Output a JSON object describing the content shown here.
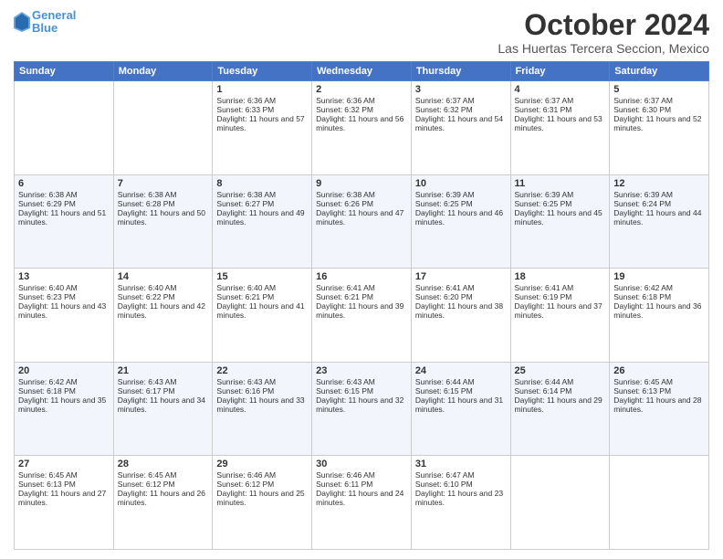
{
  "header": {
    "logo_line1": "General",
    "logo_line2": "Blue",
    "main_title": "October 2024",
    "subtitle": "Las Huertas Tercera Seccion, Mexico"
  },
  "days_of_week": [
    "Sunday",
    "Monday",
    "Tuesday",
    "Wednesday",
    "Thursday",
    "Friday",
    "Saturday"
  ],
  "weeks": [
    [
      {
        "day": "",
        "sunrise": "",
        "sunset": "",
        "daylight": ""
      },
      {
        "day": "",
        "sunrise": "",
        "sunset": "",
        "daylight": ""
      },
      {
        "day": "1",
        "sunrise": "Sunrise: 6:36 AM",
        "sunset": "Sunset: 6:33 PM",
        "daylight": "Daylight: 11 hours and 57 minutes."
      },
      {
        "day": "2",
        "sunrise": "Sunrise: 6:36 AM",
        "sunset": "Sunset: 6:32 PM",
        "daylight": "Daylight: 11 hours and 56 minutes."
      },
      {
        "day": "3",
        "sunrise": "Sunrise: 6:37 AM",
        "sunset": "Sunset: 6:32 PM",
        "daylight": "Daylight: 11 hours and 54 minutes."
      },
      {
        "day": "4",
        "sunrise": "Sunrise: 6:37 AM",
        "sunset": "Sunset: 6:31 PM",
        "daylight": "Daylight: 11 hours and 53 minutes."
      },
      {
        "day": "5",
        "sunrise": "Sunrise: 6:37 AM",
        "sunset": "Sunset: 6:30 PM",
        "daylight": "Daylight: 11 hours and 52 minutes."
      }
    ],
    [
      {
        "day": "6",
        "sunrise": "Sunrise: 6:38 AM",
        "sunset": "Sunset: 6:29 PM",
        "daylight": "Daylight: 11 hours and 51 minutes."
      },
      {
        "day": "7",
        "sunrise": "Sunrise: 6:38 AM",
        "sunset": "Sunset: 6:28 PM",
        "daylight": "Daylight: 11 hours and 50 minutes."
      },
      {
        "day": "8",
        "sunrise": "Sunrise: 6:38 AM",
        "sunset": "Sunset: 6:27 PM",
        "daylight": "Daylight: 11 hours and 49 minutes."
      },
      {
        "day": "9",
        "sunrise": "Sunrise: 6:38 AM",
        "sunset": "Sunset: 6:26 PM",
        "daylight": "Daylight: 11 hours and 47 minutes."
      },
      {
        "day": "10",
        "sunrise": "Sunrise: 6:39 AM",
        "sunset": "Sunset: 6:25 PM",
        "daylight": "Daylight: 11 hours and 46 minutes."
      },
      {
        "day": "11",
        "sunrise": "Sunrise: 6:39 AM",
        "sunset": "Sunset: 6:25 PM",
        "daylight": "Daylight: 11 hours and 45 minutes."
      },
      {
        "day": "12",
        "sunrise": "Sunrise: 6:39 AM",
        "sunset": "Sunset: 6:24 PM",
        "daylight": "Daylight: 11 hours and 44 minutes."
      }
    ],
    [
      {
        "day": "13",
        "sunrise": "Sunrise: 6:40 AM",
        "sunset": "Sunset: 6:23 PM",
        "daylight": "Daylight: 11 hours and 43 minutes."
      },
      {
        "day": "14",
        "sunrise": "Sunrise: 6:40 AM",
        "sunset": "Sunset: 6:22 PM",
        "daylight": "Daylight: 11 hours and 42 minutes."
      },
      {
        "day": "15",
        "sunrise": "Sunrise: 6:40 AM",
        "sunset": "Sunset: 6:21 PM",
        "daylight": "Daylight: 11 hours and 41 minutes."
      },
      {
        "day": "16",
        "sunrise": "Sunrise: 6:41 AM",
        "sunset": "Sunset: 6:21 PM",
        "daylight": "Daylight: 11 hours and 39 minutes."
      },
      {
        "day": "17",
        "sunrise": "Sunrise: 6:41 AM",
        "sunset": "Sunset: 6:20 PM",
        "daylight": "Daylight: 11 hours and 38 minutes."
      },
      {
        "day": "18",
        "sunrise": "Sunrise: 6:41 AM",
        "sunset": "Sunset: 6:19 PM",
        "daylight": "Daylight: 11 hours and 37 minutes."
      },
      {
        "day": "19",
        "sunrise": "Sunrise: 6:42 AM",
        "sunset": "Sunset: 6:18 PM",
        "daylight": "Daylight: 11 hours and 36 minutes."
      }
    ],
    [
      {
        "day": "20",
        "sunrise": "Sunrise: 6:42 AM",
        "sunset": "Sunset: 6:18 PM",
        "daylight": "Daylight: 11 hours and 35 minutes."
      },
      {
        "day": "21",
        "sunrise": "Sunrise: 6:43 AM",
        "sunset": "Sunset: 6:17 PM",
        "daylight": "Daylight: 11 hours and 34 minutes."
      },
      {
        "day": "22",
        "sunrise": "Sunrise: 6:43 AM",
        "sunset": "Sunset: 6:16 PM",
        "daylight": "Daylight: 11 hours and 33 minutes."
      },
      {
        "day": "23",
        "sunrise": "Sunrise: 6:43 AM",
        "sunset": "Sunset: 6:15 PM",
        "daylight": "Daylight: 11 hours and 32 minutes."
      },
      {
        "day": "24",
        "sunrise": "Sunrise: 6:44 AM",
        "sunset": "Sunset: 6:15 PM",
        "daylight": "Daylight: 11 hours and 31 minutes."
      },
      {
        "day": "25",
        "sunrise": "Sunrise: 6:44 AM",
        "sunset": "Sunset: 6:14 PM",
        "daylight": "Daylight: 11 hours and 29 minutes."
      },
      {
        "day": "26",
        "sunrise": "Sunrise: 6:45 AM",
        "sunset": "Sunset: 6:13 PM",
        "daylight": "Daylight: 11 hours and 28 minutes."
      }
    ],
    [
      {
        "day": "27",
        "sunrise": "Sunrise: 6:45 AM",
        "sunset": "Sunset: 6:13 PM",
        "daylight": "Daylight: 11 hours and 27 minutes."
      },
      {
        "day": "28",
        "sunrise": "Sunrise: 6:45 AM",
        "sunset": "Sunset: 6:12 PM",
        "daylight": "Daylight: 11 hours and 26 minutes."
      },
      {
        "day": "29",
        "sunrise": "Sunrise: 6:46 AM",
        "sunset": "Sunset: 6:12 PM",
        "daylight": "Daylight: 11 hours and 25 minutes."
      },
      {
        "day": "30",
        "sunrise": "Sunrise: 6:46 AM",
        "sunset": "Sunset: 6:11 PM",
        "daylight": "Daylight: 11 hours and 24 minutes."
      },
      {
        "day": "31",
        "sunrise": "Sunrise: 6:47 AM",
        "sunset": "Sunset: 6:10 PM",
        "daylight": "Daylight: 11 hours and 23 minutes."
      },
      {
        "day": "",
        "sunrise": "",
        "sunset": "",
        "daylight": ""
      },
      {
        "day": "",
        "sunrise": "",
        "sunset": "",
        "daylight": ""
      }
    ]
  ]
}
